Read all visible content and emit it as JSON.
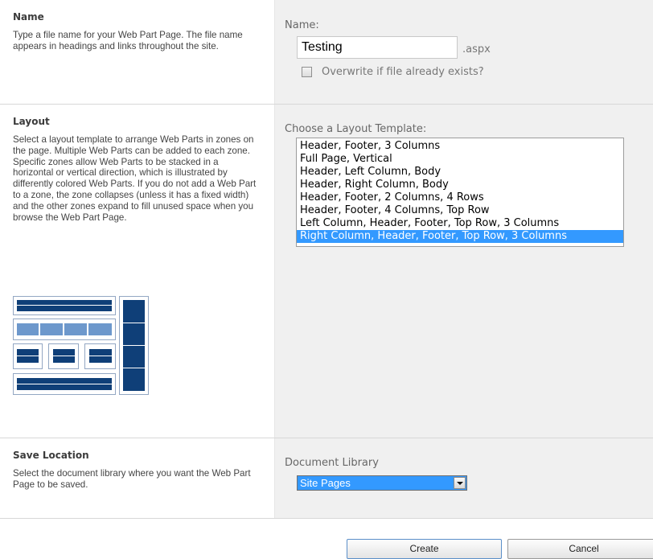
{
  "name_section": {
    "heading": "Name",
    "description": "Type a file name for your Web Part Page.  The file name appears in headings and links throughout the site.",
    "field_label": "Name:",
    "value": "Testing",
    "extension": ".aspx",
    "overwrite_label": "Overwrite if file already exists?",
    "overwrite_checked": false
  },
  "layout_section": {
    "heading": "Layout",
    "description": "Select a layout template to arrange Web Parts in zones on the page. Multiple Web Parts can be added to each zone. Specific zones allow Web Parts to be stacked in a horizontal or vertical direction, which is illustrated by differently colored Web Parts. If you do not add a Web Part to a zone, the zone collapses (unless it has a fixed width) and the other zones expand to fill unused space when you browse the Web Part Page.",
    "field_label": "Choose a Layout Template:",
    "options": [
      "Header, Footer, 3 Columns",
      "Full Page, Vertical",
      "Header, Left Column, Body",
      "Header, Right Column, Body",
      "Header, Footer, 2 Columns, 4 Rows",
      "Header, Footer, 4 Columns, Top Row",
      "Left Column, Header, Footer, Top Row, 3 Columns",
      "Right Column, Header, Footer, Top Row, 3 Columns"
    ],
    "selected": "Right Column, Header, Footer, Top Row, 3 Columns"
  },
  "save_section": {
    "heading": "Save Location",
    "description": "Select the document library where you want the Web Part Page to be saved.",
    "field_label": "Document Library",
    "selected": "Site Pages"
  },
  "buttons": {
    "create": "Create",
    "cancel": "Cancel"
  },
  "colors": {
    "selection": "#3399ff",
    "zone_dark": "#0f3f78",
    "zone_light": "#6d98cc",
    "panel_bg": "#f0f0f0"
  }
}
